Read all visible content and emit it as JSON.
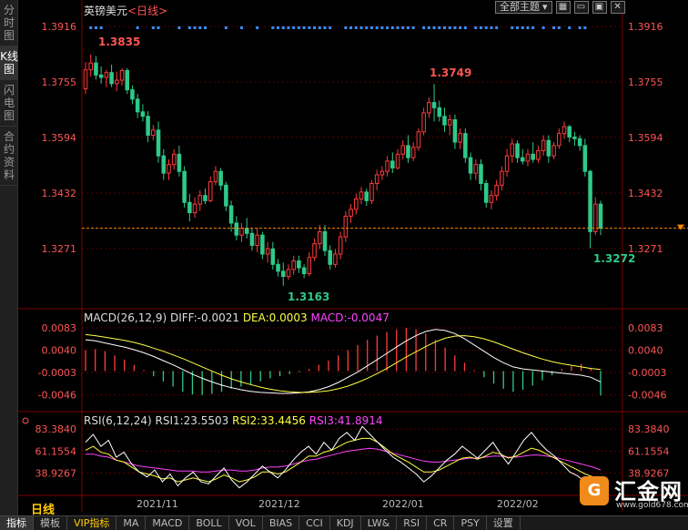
{
  "sidebar": {
    "tabs": [
      {
        "label": "分时图",
        "active": false
      },
      {
        "label": "K线图",
        "active": true
      },
      {
        "label": "闪电图",
        "active": false
      },
      {
        "label": "合约资料",
        "active": false
      }
    ]
  },
  "header": {
    "symbol": "英镑美元",
    "period": "<日线>",
    "theme_select": "全部主题",
    "icons": [
      "grid-icon",
      "minimize-icon",
      "restore-icon",
      "close-icon"
    ]
  },
  "main_axis": {
    "ticks": [
      "1.3916",
      "1.3755",
      "1.3594",
      "1.3432",
      "1.3271"
    ],
    "tick_values": [
      1.3916,
      1.3755,
      1.3594,
      1.3432,
      1.3271
    ],
    "annotations": {
      "high1": "1.3835",
      "high2": "1.3749",
      "low1": "1.3163",
      "last": "1.3272"
    }
  },
  "macd": {
    "name": "MACD(26,12,9)",
    "diff": "DIFF:-0.0021",
    "dea": "DEA:0.0003",
    "macd": "MACD:-0.0047",
    "ticks": [
      "0.0083",
      "0.0040",
      "-0.0003",
      "-0.0046"
    ]
  },
  "rsi": {
    "name": "RSI(6,12,24)",
    "rsi1": "RSI1:23.5503",
    "rsi2": "RSI2:33.4456",
    "rsi3": "RSI3:41.8914",
    "ticks": [
      "83.3840",
      "61.1554",
      "38.9267"
    ]
  },
  "x_axis": {
    "period_label": "日线",
    "labels": [
      "2021/11",
      "2021/12",
      "2022/01",
      "2022/02"
    ]
  },
  "bottom_tabs": [
    {
      "label": "指标",
      "active": true
    },
    {
      "label": "模板"
    },
    {
      "label": "VIP指标",
      "vip": true
    },
    {
      "label": "MA"
    },
    {
      "label": "MACD"
    },
    {
      "label": "BOLL"
    },
    {
      "label": "VOL"
    },
    {
      "label": "BIAS"
    },
    {
      "label": "CCI"
    },
    {
      "label": "KDJ"
    },
    {
      "label": "LW&"
    },
    {
      "label": "RSI"
    },
    {
      "label": "CR"
    },
    {
      "label": "PSY"
    },
    {
      "label": "设置"
    }
  ],
  "watermark": {
    "text": "汇金网",
    "url": "www.gold678.com"
  },
  "colors": {
    "up": "#ff3b3b",
    "down": "#2fc98a",
    "grid": "#7a0000",
    "label": "#ff5555",
    "dea": "#ffff44",
    "rsi3": "#ff44ff"
  },
  "chart_data": {
    "type": "candlestick",
    "ylim": [
      1.312,
      1.394
    ],
    "candles": [
      [
        1.3735,
        1.3812,
        1.372,
        1.379
      ],
      [
        1.379,
        1.3835,
        1.377,
        1.381
      ],
      [
        1.381,
        1.383,
        1.3762,
        1.3775
      ],
      [
        1.3775,
        1.38,
        1.375,
        1.3768
      ],
      [
        1.3768,
        1.379,
        1.374,
        1.3782
      ],
      [
        1.3782,
        1.3805,
        1.374,
        1.375
      ],
      [
        1.375,
        1.3785,
        1.3728,
        1.376
      ],
      [
        1.376,
        1.3795,
        1.3745,
        1.3788
      ],
      [
        1.3788,
        1.3795,
        1.372,
        1.3732
      ],
      [
        1.3732,
        1.3745,
        1.369,
        1.3705
      ],
      [
        1.3705,
        1.372,
        1.365,
        1.3668
      ],
      [
        1.3668,
        1.369,
        1.364,
        1.3655
      ],
      [
        1.3655,
        1.367,
        1.358,
        1.36
      ],
      [
        1.36,
        1.363,
        1.3585,
        1.3615
      ],
      [
        1.3615,
        1.364,
        1.352,
        1.354
      ],
      [
        1.354,
        1.356,
        1.347,
        1.349
      ],
      [
        1.349,
        1.353,
        1.347,
        1.3515
      ],
      [
        1.3515,
        1.356,
        1.35,
        1.3545
      ],
      [
        1.3545,
        1.357,
        1.348,
        1.3495
      ],
      [
        1.3495,
        1.351,
        1.339,
        1.3405
      ],
      [
        1.3405,
        1.343,
        1.335,
        1.3375
      ],
      [
        1.3375,
        1.342,
        1.336,
        1.34
      ],
      [
        1.34,
        1.344,
        1.338,
        1.3425
      ],
      [
        1.3425,
        1.3445,
        1.34,
        1.341
      ],
      [
        1.341,
        1.348,
        1.3405,
        1.3465
      ],
      [
        1.3465,
        1.351,
        1.3455,
        1.3495
      ],
      [
        1.3495,
        1.3505,
        1.344,
        1.3455
      ],
      [
        1.3455,
        1.3465,
        1.338,
        1.3395
      ],
      [
        1.3395,
        1.341,
        1.332,
        1.3345
      ],
      [
        1.3345,
        1.3365,
        1.3295,
        1.331
      ],
      [
        1.331,
        1.3345,
        1.329,
        1.333
      ],
      [
        1.333,
        1.336,
        1.33,
        1.3315
      ],
      [
        1.3315,
        1.333,
        1.3265,
        1.328
      ],
      [
        1.328,
        1.333,
        1.326,
        1.331
      ],
      [
        1.331,
        1.332,
        1.324,
        1.3255
      ],
      [
        1.3255,
        1.329,
        1.323,
        1.327
      ],
      [
        1.327,
        1.329,
        1.321,
        1.3225
      ],
      [
        1.3225,
        1.324,
        1.319,
        1.3205
      ],
      [
        1.3205,
        1.323,
        1.3163,
        1.319
      ],
      [
        1.319,
        1.3225,
        1.318,
        1.321
      ],
      [
        1.321,
        1.325,
        1.3195,
        1.3235
      ],
      [
        1.3235,
        1.325,
        1.32,
        1.3215
      ],
      [
        1.3215,
        1.3225,
        1.3185,
        1.3198
      ],
      [
        1.3198,
        1.326,
        1.319,
        1.3245
      ],
      [
        1.3245,
        1.33,
        1.3235,
        1.3285
      ],
      [
        1.3285,
        1.334,
        1.327,
        1.332
      ],
      [
        1.332,
        1.334,
        1.325,
        1.3265
      ],
      [
        1.3265,
        1.328,
        1.321,
        1.3225
      ],
      [
        1.3225,
        1.327,
        1.3215,
        1.3255
      ],
      [
        1.3255,
        1.332,
        1.324,
        1.3305
      ],
      [
        1.3305,
        1.338,
        1.329,
        1.3365
      ],
      [
        1.3365,
        1.34,
        1.3345,
        1.3385
      ],
      [
        1.3385,
        1.343,
        1.337,
        1.3415
      ],
      [
        1.3415,
        1.345,
        1.34,
        1.3435
      ],
      [
        1.3435,
        1.3445,
        1.3395,
        1.341
      ],
      [
        1.341,
        1.347,
        1.34,
        1.346
      ],
      [
        1.346,
        1.35,
        1.344,
        1.3485
      ],
      [
        1.3485,
        1.351,
        1.347,
        1.3495
      ],
      [
        1.3495,
        1.354,
        1.348,
        1.3525
      ],
      [
        1.3525,
        1.355,
        1.349,
        1.3505
      ],
      [
        1.3505,
        1.356,
        1.35,
        1.3545
      ],
      [
        1.3545,
        1.3585,
        1.353,
        1.357
      ],
      [
        1.357,
        1.36,
        1.352,
        1.3535
      ],
      [
        1.3535,
        1.358,
        1.3525,
        1.3565
      ],
      [
        1.3565,
        1.362,
        1.3555,
        1.361
      ],
      [
        1.361,
        1.368,
        1.36,
        1.3665
      ],
      [
        1.3665,
        1.371,
        1.365,
        1.3695
      ],
      [
        1.3695,
        1.3749,
        1.364,
        1.368
      ],
      [
        1.368,
        1.37,
        1.364,
        1.3655
      ],
      [
        1.3655,
        1.368,
        1.361,
        1.363
      ],
      [
        1.363,
        1.366,
        1.36,
        1.3645
      ],
      [
        1.3645,
        1.366,
        1.356,
        1.358
      ],
      [
        1.358,
        1.362,
        1.356,
        1.3605
      ],
      [
        1.3605,
        1.362,
        1.352,
        1.3535
      ],
      [
        1.3535,
        1.355,
        1.347,
        1.349
      ],
      [
        1.349,
        1.353,
        1.347,
        1.3515
      ],
      [
        1.3515,
        1.353,
        1.344,
        1.346
      ],
      [
        1.346,
        1.347,
        1.339,
        1.3405
      ],
      [
        1.3405,
        1.344,
        1.3385,
        1.3425
      ],
      [
        1.3425,
        1.347,
        1.341,
        1.3455
      ],
      [
        1.3455,
        1.351,
        1.344,
        1.3495
      ],
      [
        1.3495,
        1.356,
        1.348,
        1.354
      ],
      [
        1.354,
        1.359,
        1.352,
        1.3575
      ],
      [
        1.3575,
        1.3585,
        1.352,
        1.3535
      ],
      [
        1.3535,
        1.356,
        1.3515,
        1.3525
      ],
      [
        1.3525,
        1.356,
        1.351,
        1.3545
      ],
      [
        1.3545,
        1.358,
        1.352,
        1.353
      ],
      [
        1.353,
        1.357,
        1.352,
        1.3555
      ],
      [
        1.3555,
        1.36,
        1.354,
        1.3585
      ],
      [
        1.3585,
        1.36,
        1.352,
        1.354
      ],
      [
        1.354,
        1.358,
        1.353,
        1.357
      ],
      [
        1.357,
        1.362,
        1.356,
        1.3605
      ],
      [
        1.3605,
        1.364,
        1.359,
        1.3625
      ],
      [
        1.3625,
        1.363,
        1.358,
        1.3595
      ],
      [
        1.3595,
        1.361,
        1.357,
        1.359
      ],
      [
        1.359,
        1.36,
        1.3555,
        1.357
      ],
      [
        1.357,
        1.359,
        1.348,
        1.3495
      ],
      [
        1.3495,
        1.35,
        1.3272,
        1.332
      ],
      [
        1.332,
        1.342,
        1.331,
        1.34
      ],
      [
        1.34,
        1.341,
        1.331,
        1.333
      ]
    ],
    "macd": {
      "diff": [
        0.006,
        0.0058,
        0.0054,
        0.005,
        0.0046,
        0.0041,
        0.0035,
        0.0028,
        0.002,
        0.0012,
        0.0003,
        -0.0006,
        -0.0014,
        -0.0021,
        -0.0027,
        -0.0032,
        -0.0036,
        -0.0039,
        -0.0041,
        -0.0042,
        -0.0043,
        -0.0043,
        -0.0042,
        -0.004,
        -0.0036,
        -0.003,
        -0.0022,
        -0.0012,
        -0.0002,
        0.001,
        0.0022,
        0.0034,
        0.0046,
        0.0058,
        0.0068,
        0.0076,
        0.008,
        0.0078,
        0.0072,
        0.0062,
        0.005,
        0.0038,
        0.0026,
        0.0016,
        0.0008,
        0.0004,
        0.0002,
        0.0,
        -0.0002,
        -0.0004,
        -0.0006,
        -0.0008,
        -0.0012,
        -0.0021
      ],
      "dea": [
        0.007,
        0.0068,
        0.0065,
        0.0062,
        0.0059,
        0.0055,
        0.005,
        0.0044,
        0.0038,
        0.0031,
        0.0024,
        0.0016,
        0.0008,
        0.0,
        -0.0008,
        -0.0015,
        -0.0021,
        -0.0026,
        -0.0031,
        -0.0035,
        -0.0038,
        -0.004,
        -0.0041,
        -0.0041,
        -0.004,
        -0.0038,
        -0.0034,
        -0.0029,
        -0.0022,
        -0.0014,
        -0.0005,
        0.0005,
        0.0016,
        0.0027,
        0.0037,
        0.0047,
        0.0056,
        0.0063,
        0.0067,
        0.0068,
        0.0066,
        0.0062,
        0.0056,
        0.0049,
        0.0042,
        0.0035,
        0.0029,
        0.0023,
        0.0018,
        0.0014,
        0.0011,
        0.0008,
        0.0005,
        0.0003
      ],
      "hist": [
        0.004,
        0.0042,
        0.0038,
        0.003,
        0.0022,
        0.0012,
        0.0002,
        -0.001,
        -0.002,
        -0.003,
        -0.004,
        -0.0045,
        -0.0046,
        -0.0044,
        -0.004,
        -0.0034,
        -0.003,
        -0.0026,
        -0.002,
        -0.0014,
        -0.001,
        -0.0006,
        -0.0002,
        0.0004,
        0.0012,
        0.002,
        0.003,
        0.004,
        0.005,
        0.006,
        0.0068,
        0.0075,
        0.008,
        0.0083,
        0.008,
        0.0072,
        0.006,
        0.0045,
        0.003,
        0.0016,
        0.0002,
        -0.0012,
        -0.0024,
        -0.0034,
        -0.004,
        -0.0036,
        -0.0028,
        -0.0018,
        -0.0008,
        0.0004,
        0.001,
        0.0014,
        0.0006,
        -0.0047
      ]
    },
    "rsi": {
      "rsi1": [
        70,
        78,
        66,
        72,
        55,
        60,
        48,
        40,
        35,
        42,
        30,
        38,
        26,
        34,
        40,
        30,
        28,
        36,
        44,
        32,
        24,
        30,
        38,
        46,
        40,
        34,
        42,
        52,
        60,
        66,
        58,
        70,
        62,
        74,
        80,
        72,
        86,
        78,
        70,
        62,
        55,
        50,
        44,
        38,
        30,
        36,
        44,
        52,
        58,
        66,
        60,
        54,
        62,
        70,
        58,
        48,
        60,
        72,
        80,
        70,
        62,
        56,
        48,
        40,
        36,
        30,
        24,
        23.5503
      ],
      "rsi2": [
        62,
        66,
        60,
        58,
        52,
        50,
        45,
        40,
        38,
        36,
        33,
        34,
        30,
        32,
        34,
        32,
        30,
        33,
        37,
        34,
        30,
        32,
        35,
        40,
        40,
        38,
        40,
        45,
        50,
        56,
        56,
        60,
        62,
        66,
        70,
        72,
        74,
        74,
        70,
        64,
        58,
        54,
        50,
        45,
        40,
        40,
        42,
        46,
        50,
        54,
        55,
        53,
        56,
        60,
        58,
        54,
        56,
        60,
        64,
        62,
        58,
        54,
        50,
        46,
        42,
        38,
        35,
        33.4456
      ],
      "rsi3": [
        58,
        58,
        56,
        55,
        52,
        50,
        48,
        46,
        45,
        44,
        43,
        42,
        41,
        41,
        41,
        40,
        40,
        41,
        42,
        42,
        41,
        41,
        42,
        44,
        45,
        45,
        46,
        48,
        50,
        52,
        53,
        55,
        57,
        59,
        61,
        62,
        63,
        64,
        63,
        61,
        59,
        57,
        55,
        53,
        51,
        50,
        50,
        51,
        52,
        53,
        54,
        54,
        55,
        56,
        56,
        55,
        55,
        56,
        57,
        57,
        56,
        55,
        53,
        51,
        49,
        47,
        45,
        41.8914
      ]
    }
  }
}
